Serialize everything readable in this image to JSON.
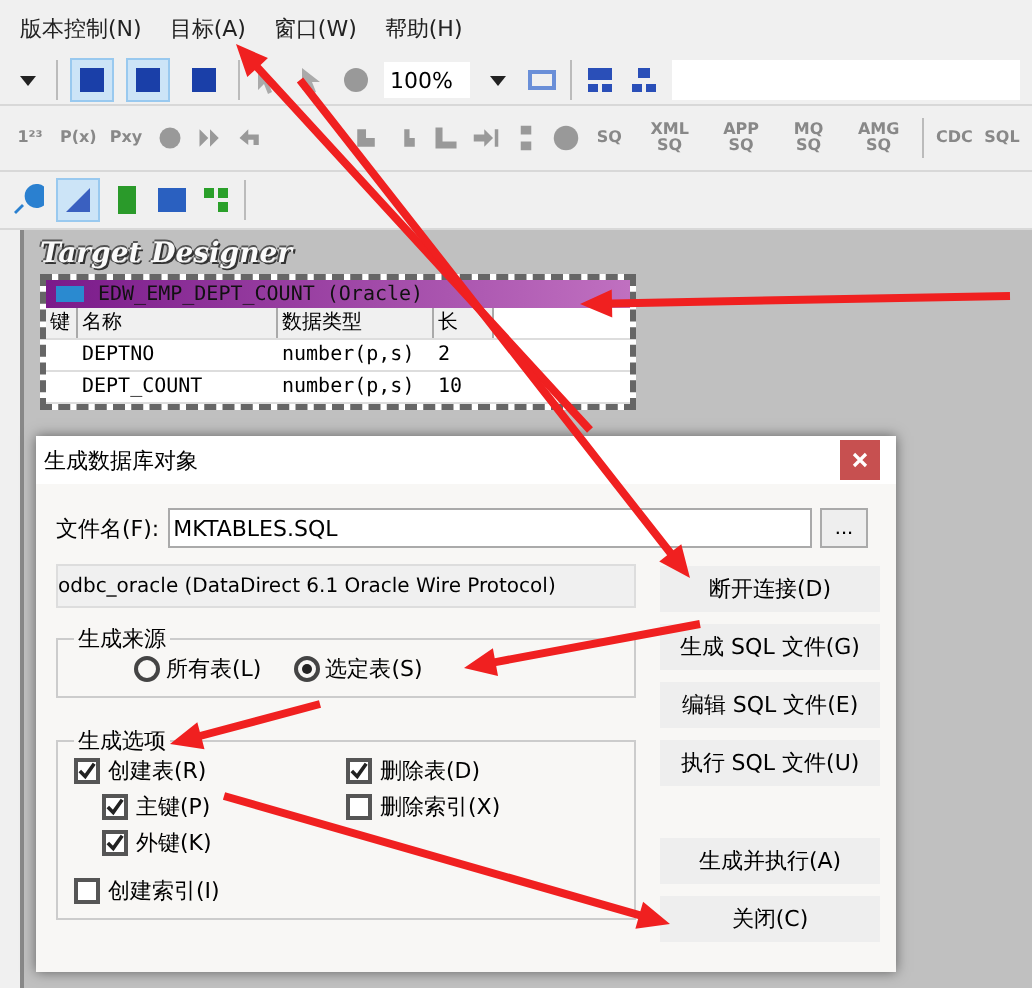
{
  "menu": [
    {
      "label": "版本控制(N)"
    },
    {
      "label": "目标(A)"
    },
    {
      "label": "窗口(W)"
    },
    {
      "label": "帮助(H)"
    }
  ],
  "toolbar": {
    "zoom": "100%"
  },
  "toolbar_2": [
    "1²³",
    "P(x)",
    "Pxy",
    "SQ",
    "XML SQ",
    "APP SQ",
    "MQ SQ",
    "AMG SQ",
    "CDC",
    "SQL"
  ],
  "workspace": {
    "title": "Target Designer"
  },
  "table_window": {
    "title": "EDW_EMP_DEPT_COUNT (Oracle)",
    "columns": [
      "键",
      "名称",
      "数据类型",
      "长"
    ],
    "rows": [
      {
        "name": "DEPTNO",
        "type": "number(p,s)",
        "length": "2"
      },
      {
        "name": "DEPT_COUNT",
        "type": "number(p,s)",
        "length": "10"
      }
    ]
  },
  "dialog": {
    "title": "生成数据库对象",
    "file_label": "文件名(F):",
    "file_value": "MKTABLES.SQL",
    "browse": "...",
    "connection": "odbc_oracle (DataDirect 6.1 Oracle Wire Protocol)",
    "source": {
      "label": "生成来源",
      "options": [
        {
          "label": "所有表(L)",
          "selected": false
        },
        {
          "label": "选定表(S)",
          "selected": true
        }
      ]
    },
    "options": {
      "label": "生成选项",
      "column_1": [
        {
          "label": "创建表(R)",
          "checked": true,
          "children": [
            {
              "label": "主键(P)",
              "checked": true
            },
            {
              "label": "外键(K)",
              "checked": true
            }
          ]
        },
        {
          "label": "创建索引(I)",
          "checked": false
        }
      ],
      "column_2": [
        {
          "label": "删除表(D)",
          "checked": true
        },
        {
          "label": "删除索引(X)",
          "checked": false
        }
      ]
    },
    "buttons": [
      "断开连接(D)",
      "生成 SQL 文件(G)",
      "编辑 SQL 文件(E)",
      "执行 SQL 文件(U)"
    ],
    "bottom_buttons": [
      "生成并执行(A)",
      "关闭(C)"
    ]
  }
}
